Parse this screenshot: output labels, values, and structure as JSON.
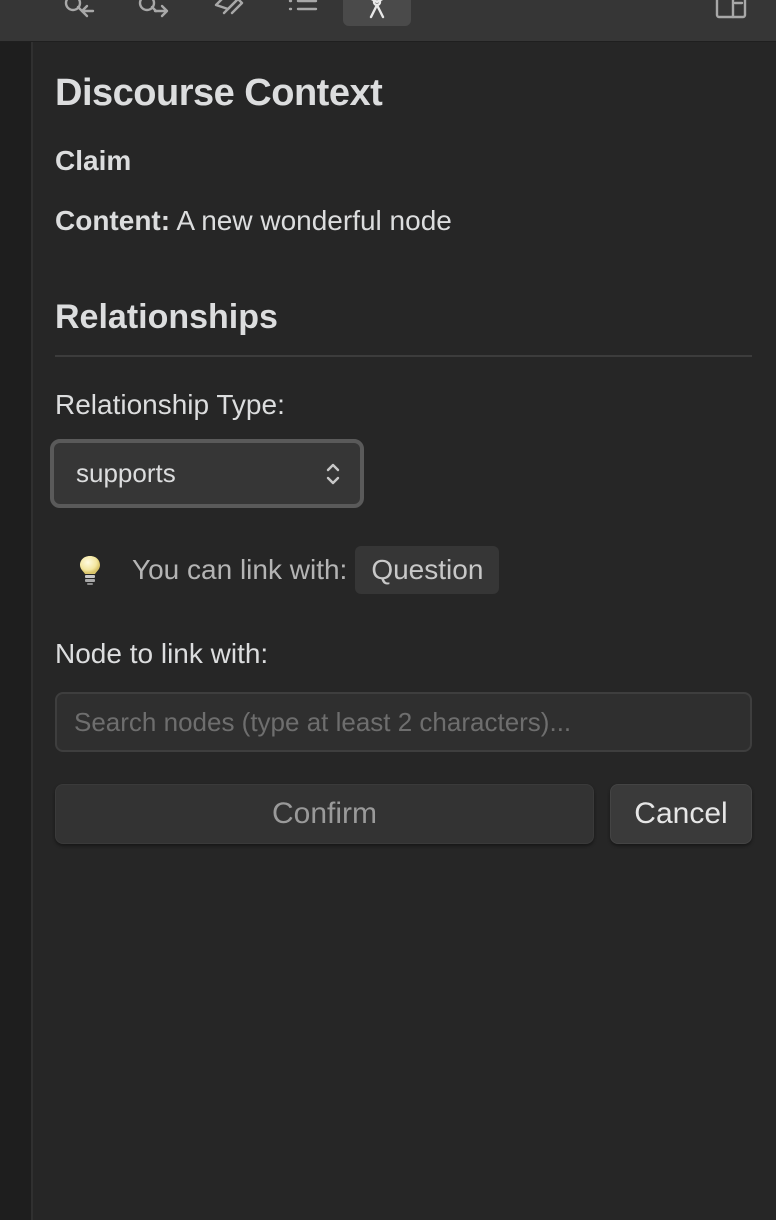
{
  "toolbar": {
    "buttons": [
      {
        "icon": "backlinks-icon"
      },
      {
        "icon": "outgoing-links-icon"
      },
      {
        "icon": "tags-icon"
      },
      {
        "icon": "outline-icon"
      },
      {
        "icon": "discourse-graph-icon",
        "active": true
      }
    ],
    "right_icon": "split-view-icon"
  },
  "panel": {
    "title": "Discourse Context",
    "node_type": "Claim",
    "content_label": "Content:",
    "content_value": "A new wonderful node"
  },
  "relationships": {
    "heading": "Relationships",
    "type_label": "Relationship Type:",
    "selected_type": "supports",
    "hint_icon": "lightbulb-icon",
    "hint_text": "You can link with:",
    "hint_chip": "Question",
    "node_label": "Node to link with:",
    "search_placeholder": "Search nodes (type at least 2 characters)...",
    "search_value": "",
    "confirm_label": "Confirm",
    "cancel_label": "Cancel"
  },
  "colors": {
    "background": "#262626",
    "toolbar": "#363636",
    "text": "#dcddde",
    "muted": "#9a9a9a"
  }
}
